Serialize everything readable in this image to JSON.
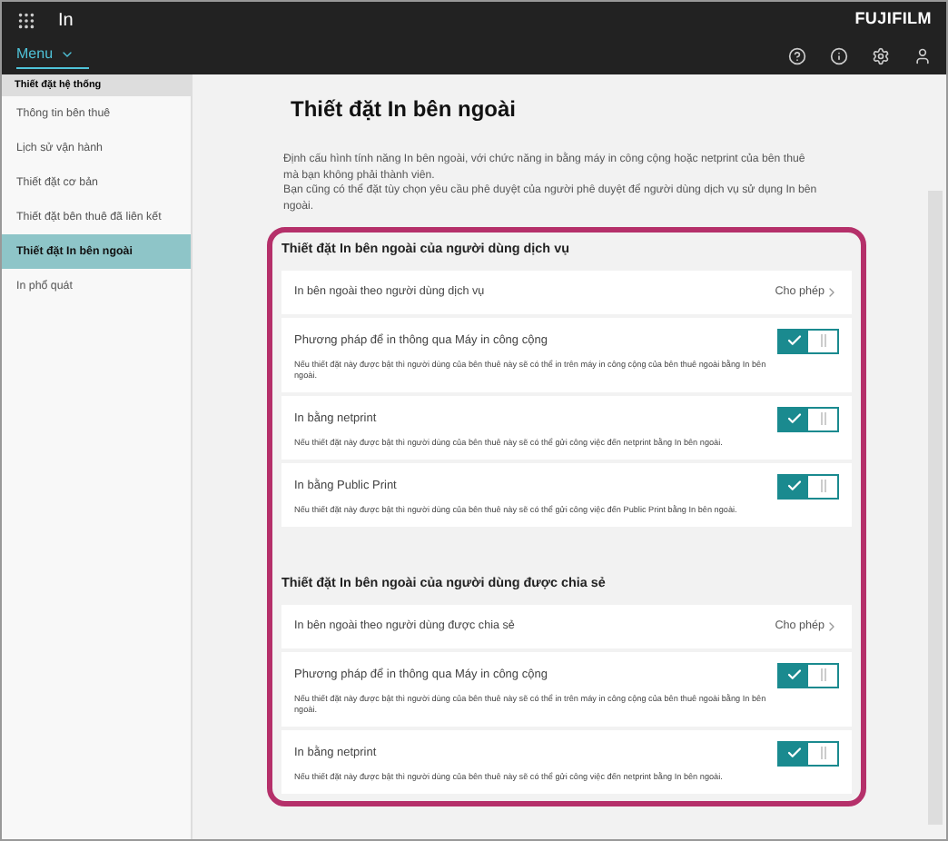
{
  "header": {
    "app_title": "In",
    "brand": "FUJIFILM",
    "menu_label": "Menu"
  },
  "sidebar": {
    "heading": "Thiết đặt hệ thống",
    "items": [
      {
        "label": "Thông tin bên thuê",
        "selected": false
      },
      {
        "label": "Lịch sử vận hành",
        "selected": false
      },
      {
        "label": "Thiết đặt cơ bản",
        "selected": false
      },
      {
        "label": "Thiết đặt bên thuê đã liên kết",
        "selected": false
      },
      {
        "label": "Thiết đặt In bên ngoài",
        "selected": true
      },
      {
        "label": "In phổ quát",
        "selected": false
      }
    ]
  },
  "page": {
    "title": "Thiết đặt In bên ngoài",
    "description": [
      "Định cấu hình tính năng In bên ngoài, với chức năng in bằng máy in công cộng hoặc netprint của bên thuê mà bạn không phải thành viên.",
      "Bạn cũng có thể đặt tùy chọn yêu cầu phê duyệt của người phê duyệt để người dùng dịch vụ sử dụng In bên ngoài."
    ]
  },
  "sections": [
    {
      "title": "Thiết đặt In bên ngoài của người dùng dịch vụ",
      "rows": [
        {
          "kind": "link",
          "label": "In bên ngoài theo người dùng dịch vụ",
          "value": "Cho phép"
        },
        {
          "kind": "toggle",
          "label": "Phương pháp để in thông qua Máy in công cộng",
          "note": "Nếu thiết đặt này được bật thì người dùng của bên thuê này sẽ có thể in trên máy in công cộng của bên thuê ngoài bằng In bên ngoài.",
          "on": true
        },
        {
          "kind": "toggle",
          "label": "In bằng netprint",
          "note": "Nếu thiết đặt này được bật thì người dùng của bên thuê này sẽ có thể gửi công việc đến netprint bằng In bên ngoài.",
          "on": true
        },
        {
          "kind": "toggle",
          "label": "In bằng Public Print",
          "note": "Nếu thiết đặt này được bật thì người dùng của bên thuê này sẽ có thể gửi công việc đến Public Print bằng In bên ngoài.",
          "on": true
        }
      ]
    },
    {
      "title": "Thiết đặt In bên ngoài của người dùng được chia sẻ",
      "rows": [
        {
          "kind": "link",
          "label": "In bên ngoài theo người dùng được chia sẻ",
          "value": "Cho phép"
        },
        {
          "kind": "toggle",
          "label": "Phương pháp để in thông qua Máy in công cộng",
          "note": "Nếu thiết đặt này được bật thì người dùng của bên thuê này sẽ có thể in trên máy in công cộng của bên thuê ngoài bằng In bên ngoài.",
          "on": true
        },
        {
          "kind": "toggle",
          "label": "In bằng netprint",
          "note": "Nếu thiết đặt này được bật thì người dùng của bên thuê này sẽ có thể gửi công việc đến netprint bằng In bên ngoài.",
          "on": true
        }
      ]
    }
  ]
}
